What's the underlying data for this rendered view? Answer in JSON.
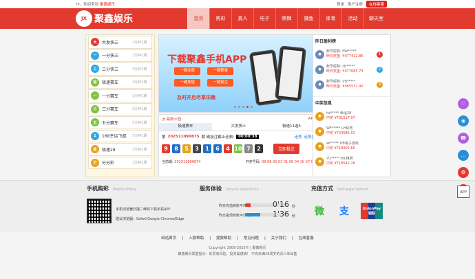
{
  "topbar": {
    "greeting": "Hi，欢迎来到",
    "site": "聚鑫娱乐",
    "login": "登录",
    "register": "用户注册",
    "online": "在线客服"
  },
  "logo": {
    "badge": "JX",
    "name": "聚鑫娱乐"
  },
  "nav": [
    "首页",
    "购彩",
    "真人",
    "电子",
    "棋牌",
    "捕鱼",
    "体育",
    "活动",
    "聊天室"
  ],
  "lotteries": [
    {
      "name": "大发快三",
      "freq": "1分钟1期",
      "color": "#e23a2e"
    },
    {
      "name": "一分快三",
      "freq": "1分钟1期",
      "color": "#31a8e0"
    },
    {
      "name": "三分快三",
      "freq": "3分钟1期",
      "color": "#31a8e0"
    },
    {
      "name": "极速赛车",
      "freq": "1分钟1期",
      "color": "#7ec34a"
    },
    {
      "name": "一分赛车",
      "freq": "1分钟1期",
      "color": "#7ec34a"
    },
    {
      "name": "三分赛车",
      "freq": "3分钟1期",
      "color": "#7ec34a"
    },
    {
      "name": "五分赛车",
      "freq": "5分钟1期",
      "color": "#7ec34a"
    },
    {
      "name": "168幸运飞艇",
      "freq": "5分钟1期",
      "color": "#31a8e0"
    },
    {
      "name": "极速28",
      "freq": "1分钟1期",
      "color": "#e8a21c"
    },
    {
      "name": "分分彩",
      "freq": "1分钟1期",
      "color": "#e8a21c"
    }
  ],
  "banner": {
    "title": "下载聚鑫手机APP",
    "buttons": [
      "一键注册",
      "一键登录",
      "一键充值",
      "一键投注"
    ],
    "slogan": "及时开启尽享乐趣"
  },
  "draw": {
    "notice_label": "最新公告:",
    "notice_right": "APP",
    "tabs": [
      "极速赛车",
      "大发快三",
      "极速11选5"
    ],
    "issue_label": "第",
    "issue": "202511090875",
    "issue_mid": "期 离投注截止还剩:",
    "countdown": "00:00:38",
    "trend": "走势",
    "history": "走势图",
    "balls": [
      {
        "n": "9",
        "c": "#e23a2e"
      },
      {
        "n": "8",
        "c": "#1e6ec8"
      },
      {
        "n": "5",
        "c": "#e8a21c"
      },
      {
        "n": "3",
        "c": "#444"
      },
      {
        "n": "1",
        "c": "#1e6ec8"
      },
      {
        "n": "6",
        "c": "#1e6ec8"
      },
      {
        "n": "4",
        "c": "#e23a2e"
      },
      {
        "n": "10",
        "c": "#7ec34a"
      },
      {
        "n": "7",
        "c": "#888"
      },
      {
        "n": "2",
        "c": "#333"
      }
    ],
    "bet": "立即投注",
    "current_label": "当前期:",
    "current": "202511090874",
    "open_label": "开奖号码:",
    "open": "09 08 05 03 01 06 04 10 07 02"
  },
  "winners_title": "昨日盈利榜",
  "winners": [
    {
      "acct": "账号昵称: FW*****",
      "prize": "昨日奖金: ¥977412.86",
      "rank": "1",
      "rc": "#e23a2e"
    },
    {
      "acct": "账号昵称: cb*****",
      "prize": "昨日奖金: ¥977085.73",
      "rank": "2",
      "rc": "#31a8e0"
    },
    {
      "acct": "账号昵称: V8*****",
      "prize": "昨日奖金: ¥965531.40",
      "rank": "3",
      "rc": "#e8a21c"
    }
  ],
  "recent_title": "中奖信息",
  "recent": [
    {
      "acct": "hz*****",
      "game": "幸运28",
      "prize": "中奖 ¥731517.97"
    },
    {
      "acct": "WF*****",
      "game": "LH体育",
      "prize": "中奖 ¥724585.01"
    },
    {
      "acct": "wl*****",
      "game": "DB电子游戏",
      "prize": "中奖 ¥718902.60"
    },
    {
      "acct": "7U*****",
      "game": "WL棋牌",
      "prize": "中奖 ¥718542.26"
    }
  ],
  "mobile": {
    "title": "手机购彩",
    "sub": "Mobile lottery",
    "line1": "手机浏览器扫描二维码下载手机APP",
    "line2": "建议浏览器：Safari/Google Chrome/Edge"
  },
  "service": {
    "title": "服务体验",
    "sub": "Service experience",
    "deposit_label": "昨日充值到账平均时间",
    "deposit_time": "0'16",
    "deposit_fill": 0.12,
    "withdraw_label": "昨日提现到账平均时间",
    "withdraw_time": "1'36",
    "withdraw_fill": 0.35,
    "unit": "秒"
  },
  "pay": {
    "title": "充值方式",
    "sub": "Recharge method",
    "wechat": "微",
    "alipay": "支",
    "union": "UnionPay 银联"
  },
  "links": [
    "网站首页",
    "入款帮助",
    "提款帮助",
    "常见问题",
    "关于我们",
    "在线客服"
  ],
  "copyright": "Copyright 2008-2025© | 聚鑫娱乐",
  "warning": "聚鑫娱乐郑重提示：彩票有风险，投资需谨慎！ 不向未满18周岁的青少年出售",
  "side": [
    {
      "icon": "♡",
      "c": "#b060e0"
    },
    {
      "icon": "◉",
      "c": "#2b8fd6"
    },
    {
      "icon": "☎",
      "c": "#b060e0"
    },
    {
      "icon": "…",
      "c": "#2b8fd6"
    },
    {
      "icon": "❂",
      "c": "#e23a2e"
    },
    {
      "icon": "✦",
      "c": "#e23a2e"
    }
  ],
  "side_qr": "APP"
}
